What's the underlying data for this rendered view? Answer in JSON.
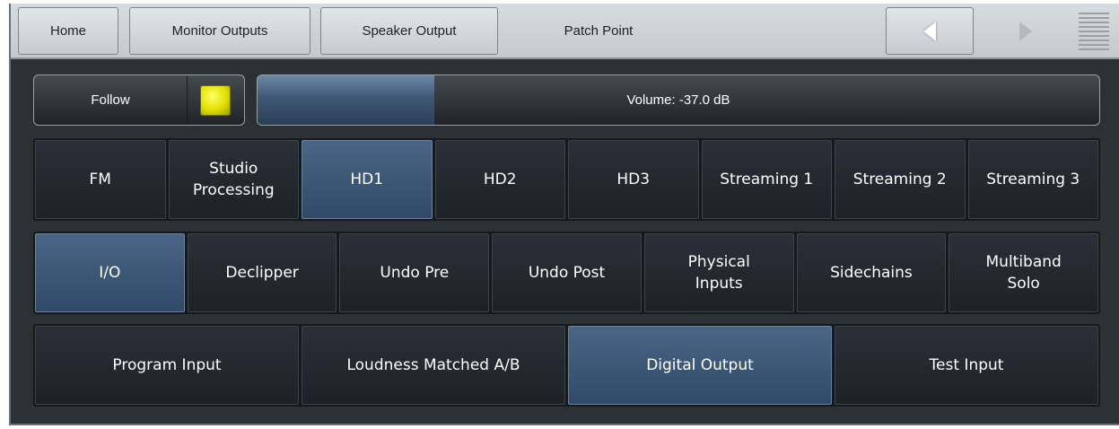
{
  "nav": {
    "home": "Home",
    "monitor_outputs": "Monitor Outputs",
    "speaker_output": "Speaker Output",
    "patch_point": "Patch Point"
  },
  "follow": {
    "label": "Follow",
    "indicator_color": "#e8e600",
    "state": "on"
  },
  "volume": {
    "label": "Volume: -37.0 dB",
    "level_fraction": 0.21
  },
  "outputs": [
    {
      "label": "FM",
      "active": false
    },
    {
      "label": "Studio\nProcessing",
      "active": false
    },
    {
      "label": "HD1",
      "active": true
    },
    {
      "label": "HD2",
      "active": false
    },
    {
      "label": "HD3",
      "active": false
    },
    {
      "label": "Streaming 1",
      "active": false
    },
    {
      "label": "Streaming 2",
      "active": false
    },
    {
      "label": "Streaming 3",
      "active": false
    }
  ],
  "sections": [
    {
      "label": "I/O",
      "active": true
    },
    {
      "label": "Declipper",
      "active": false
    },
    {
      "label": "Undo Pre",
      "active": false
    },
    {
      "label": "Undo Post",
      "active": false
    },
    {
      "label": "Physical\nInputs",
      "active": false
    },
    {
      "label": "Sidechains",
      "active": false
    },
    {
      "label": "Multiband\nSolo",
      "active": false
    }
  ],
  "pages": [
    {
      "label": "Program Input",
      "active": false
    },
    {
      "label": "Loudness Matched A/B",
      "active": false
    },
    {
      "label": "Digital Output",
      "active": true
    },
    {
      "label": "Test Input",
      "active": false
    }
  ],
  "colors": {
    "active_button": "#3d5878",
    "accent_led": "#e8e600",
    "panel_bg": "#2c3136"
  }
}
